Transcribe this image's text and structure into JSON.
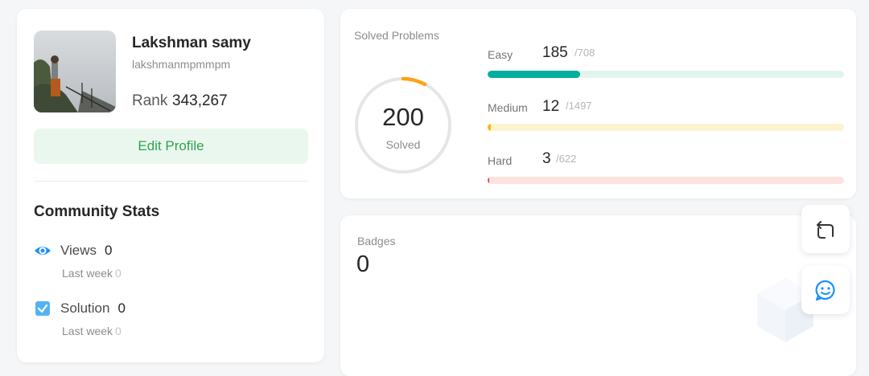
{
  "profile": {
    "name": "Lakshman samy",
    "username": "lakshmanmpmmpm",
    "rank_label": "Rank",
    "rank_value": "343,267",
    "edit_button": "Edit Profile"
  },
  "community": {
    "title": "Community Stats",
    "stats": [
      {
        "icon": "eye-icon",
        "label": "Views",
        "value": "0",
        "sub_label": "Last week",
        "sub_value": "0"
      },
      {
        "icon": "checkbox-icon",
        "label": "Solution",
        "value": "0",
        "sub_label": "Last week",
        "sub_value": "0"
      }
    ]
  },
  "solved": {
    "title": "Solved Problems",
    "total": "200",
    "total_label": "Solved",
    "difficulties": [
      {
        "label": "Easy",
        "count": "185",
        "total": "/708",
        "fraction": 0.26,
        "color": "#00af9b",
        "track": "#e2f5ec"
      },
      {
        "label": "Medium",
        "count": "12",
        "total": "/1497",
        "fraction": 0.008,
        "color": "#ffb800",
        "track": "#fdf3d0"
      },
      {
        "label": "Hard",
        "count": "3",
        "total": "/622",
        "fraction": 0.005,
        "color": "#ef4743",
        "track": "#fde2e0"
      }
    ]
  },
  "badges": {
    "title": "Badges",
    "count": "0"
  },
  "floating": {
    "share_icon": "repost-icon",
    "feedback_icon": "smiley-chat-icon"
  },
  "colors": {
    "accent_green": "#2ea44f",
    "blue_icon": "#1a90ff"
  }
}
